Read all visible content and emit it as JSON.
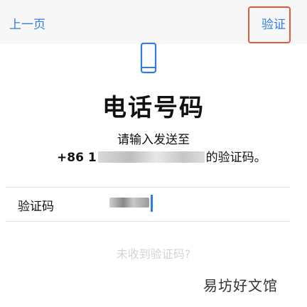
{
  "nav": {
    "back_label": "上一页",
    "verify_label": "验证",
    "highlight_color": "#e15b3a",
    "accent_color": "#2f7de1"
  },
  "icon": {
    "name": "phone-icon"
  },
  "page": {
    "title": "电话号码",
    "instruction": "请输入发送至",
    "phone_prefix": "+86 1",
    "phone_suffix": "的验证码。"
  },
  "form": {
    "code_label": "验证码"
  },
  "resend_label": "未收到验证码?",
  "watermark": {
    "text": "易坊好文馆"
  }
}
